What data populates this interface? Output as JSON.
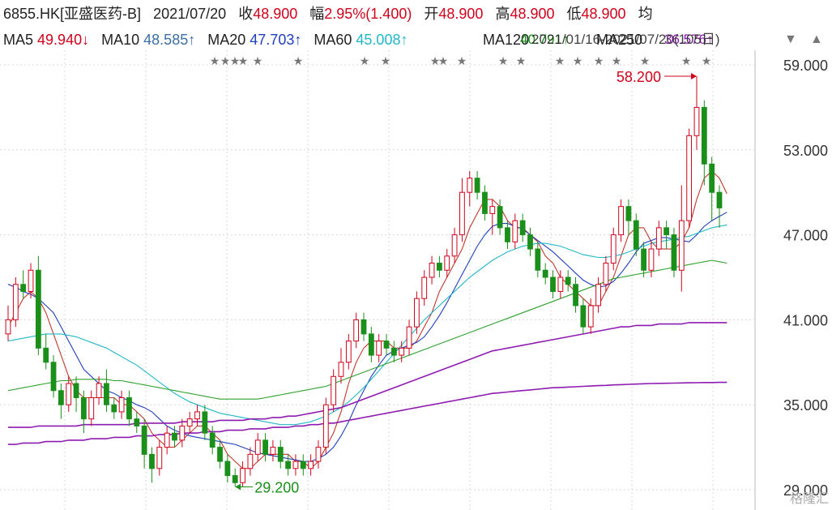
{
  "header": {
    "symbol": "6855.HK[亚盛医药-B]",
    "date": "2021/07/20",
    "close_label": "收",
    "close_value": "48.900",
    "change_label": "幅",
    "change_value": "2.95%(1.400)",
    "open_label": "开",
    "open_value": "48.900",
    "high_label": "高",
    "high_value": "48.900",
    "low_label": "低",
    "low_value": "48.900",
    "avg_label": "均"
  },
  "ma_row": {
    "ma5_label": "MA5",
    "ma5_value": "49.940↓",
    "ma10_label": "MA10",
    "ma10_value": "48.585↑",
    "ma20_label": "MA20",
    "ma20_value": "47.703↑",
    "ma60_label": "MA60",
    "ma60_value": "45.008↑",
    "ma120_label": "MA120",
    "ma120_value": "40.791↑",
    "ma250_label": "MA250",
    "ma250_value": "36.576↑",
    "range_text": "2021/01/16-2021/07/20(105日)"
  },
  "colors": {
    "candle_up": "#d0021b",
    "candle_down": "#1a8f1a",
    "ma5": "#c0392b",
    "ma10": "#1f3fbf",
    "ma20": "#22b8c8",
    "ma60": "#2ca02c",
    "ma120": "#8e1bb0",
    "grid": "#d9d9d9",
    "axis_text": "#333333"
  },
  "chart_data": {
    "type": "candlestick",
    "title": "6855.HK[亚盛医药-B]",
    "date_range": "2021/01/16-2021/07/20",
    "y_ticks": [
      "59.000",
      "53.000",
      "47.000",
      "41.000",
      "35.000",
      "29.000"
    ],
    "ylim": [
      29,
      59
    ],
    "grid": true,
    "annotations": [
      {
        "text": "58.200",
        "type": "high"
      },
      {
        "text": "29.200",
        "type": "low"
      }
    ],
    "candles": [
      [
        40.0,
        41.0,
        39.5,
        42.0
      ],
      [
        41.0,
        43.5,
        40.5,
        44.0
      ],
      [
        43.5,
        43.0,
        42.5,
        44.5
      ],
      [
        43.0,
        44.5,
        42.5,
        45.0
      ],
      [
        44.5,
        39.0,
        38.5,
        45.5
      ],
      [
        39.0,
        38.0,
        37.5,
        40.0
      ],
      [
        38.0,
        36.0,
        35.5,
        38.5
      ],
      [
        36.0,
        35.0,
        34.0,
        36.5
      ],
      [
        35.0,
        36.5,
        34.5,
        37.0
      ],
      [
        36.5,
        35.5,
        34.5,
        37.0
      ],
      [
        35.5,
        34.0,
        33.0,
        36.0
      ],
      [
        34.0,
        35.5,
        33.5,
        36.0
      ],
      [
        35.5,
        36.5,
        35.0,
        37.0
      ],
      [
        36.5,
        35.0,
        34.5,
        37.5
      ],
      [
        35.0,
        34.5,
        34.0,
        35.5
      ],
      [
        34.5,
        35.5,
        34.0,
        36.0
      ],
      [
        35.5,
        34.0,
        33.5,
        36.0
      ],
      [
        34.0,
        33.5,
        33.0,
        34.5
      ],
      [
        33.5,
        31.5,
        30.5,
        34.0
      ],
      [
        31.5,
        30.5,
        29.5,
        32.0
      ],
      [
        30.5,
        32.0,
        30.0,
        32.5
      ],
      [
        32.0,
        33.0,
        31.5,
        33.5
      ],
      [
        33.0,
        32.5,
        32.0,
        33.5
      ],
      [
        32.5,
        33.5,
        32.0,
        34.0
      ],
      [
        33.5,
        34.0,
        33.0,
        34.5
      ],
      [
        34.0,
        34.5,
        33.5,
        35.0
      ],
      [
        34.5,
        33.0,
        32.5,
        35.0
      ],
      [
        33.0,
        32.0,
        31.5,
        33.5
      ],
      [
        32.0,
        31.0,
        30.5,
        32.5
      ],
      [
        31.0,
        30.0,
        29.5,
        31.5
      ],
      [
        30.0,
        29.5,
        29.2,
        30.5
      ],
      [
        29.5,
        30.5,
        29.2,
        31.0
      ],
      [
        30.5,
        31.5,
        30.0,
        32.0
      ],
      [
        31.5,
        32.5,
        31.0,
        33.0
      ],
      [
        32.5,
        31.5,
        31.0,
        33.0
      ],
      [
        31.5,
        32.0,
        31.0,
        32.5
      ],
      [
        32.0,
        31.0,
        30.5,
        32.5
      ],
      [
        31.0,
        30.5,
        30.0,
        31.5
      ],
      [
        30.5,
        31.0,
        30.0,
        31.5
      ],
      [
        31.0,
        30.5,
        30.0,
        31.5
      ],
      [
        30.5,
        31.0,
        30.0,
        31.5
      ],
      [
        31.0,
        32.0,
        30.5,
        32.5
      ],
      [
        32.0,
        35.0,
        31.5,
        35.5
      ],
      [
        35.0,
        37.0,
        34.5,
        37.5
      ],
      [
        37.0,
        38.0,
        36.5,
        39.0
      ],
      [
        38.0,
        39.5,
        37.5,
        40.0
      ],
      [
        39.5,
        41.0,
        39.0,
        41.5
      ],
      [
        41.0,
        40.0,
        39.5,
        41.5
      ],
      [
        40.0,
        38.5,
        38.0,
        40.5
      ],
      [
        38.5,
        39.5,
        38.0,
        40.0
      ],
      [
        39.5,
        39.0,
        38.5,
        40.0
      ],
      [
        39.0,
        38.5,
        38.0,
        39.5
      ],
      [
        38.5,
        39.0,
        38.0,
        39.5
      ],
      [
        39.0,
        40.5,
        38.5,
        41.0
      ],
      [
        40.5,
        42.5,
        40.0,
        43.0
      ],
      [
        42.5,
        44.0,
        42.0,
        44.5
      ],
      [
        44.0,
        45.0,
        43.5,
        45.5
      ],
      [
        45.0,
        44.5,
        44.0,
        45.5
      ],
      [
        44.5,
        45.5,
        44.0,
        46.0
      ],
      [
        45.5,
        47.0,
        45.0,
        47.5
      ],
      [
        47.0,
        50.0,
        46.5,
        51.0
      ],
      [
        50.0,
        51.0,
        49.0,
        51.5
      ],
      [
        51.0,
        50.0,
        49.5,
        51.5
      ],
      [
        50.0,
        48.5,
        48.0,
        50.5
      ],
      [
        48.5,
        49.0,
        47.0,
        49.5
      ],
      [
        49.0,
        47.5,
        47.0,
        49.5
      ],
      [
        47.5,
        46.5,
        46.0,
        48.0
      ],
      [
        46.5,
        48.0,
        46.0,
        48.5
      ],
      [
        48.0,
        47.0,
        46.5,
        48.5
      ],
      [
        47.0,
        46.0,
        45.5,
        47.5
      ],
      [
        46.0,
        44.5,
        44.0,
        46.5
      ],
      [
        44.5,
        44.0,
        43.5,
        45.0
      ],
      [
        44.0,
        43.0,
        42.5,
        44.5
      ],
      [
        43.0,
        44.0,
        42.5,
        44.5
      ],
      [
        44.0,
        43.5,
        43.0,
        44.5
      ],
      [
        43.5,
        42.0,
        41.5,
        44.0
      ],
      [
        42.0,
        40.5,
        40.0,
        42.5
      ],
      [
        40.5,
        42.0,
        40.0,
        42.5
      ],
      [
        42.0,
        43.5,
        41.5,
        44.0
      ],
      [
        43.5,
        45.0,
        43.0,
        45.5
      ],
      [
        45.0,
        47.0,
        44.5,
        47.5
      ],
      [
        47.0,
        49.0,
        46.5,
        49.5
      ],
      [
        49.0,
        48.0,
        47.0,
        49.5
      ],
      [
        48.0,
        46.0,
        45.5,
        48.5
      ],
      [
        46.0,
        44.5,
        44.0,
        46.5
      ],
      [
        44.5,
        46.0,
        44.0,
        46.5
      ],
      [
        46.0,
        47.5,
        45.5,
        48.0
      ],
      [
        47.5,
        47.0,
        46.0,
        48.0
      ],
      [
        47.0,
        44.5,
        44.0,
        47.5
      ],
      [
        44.5,
        48.0,
        43.0,
        50.5
      ],
      [
        48.0,
        54.0,
        47.5,
        54.5
      ],
      [
        54.0,
        56.0,
        53.0,
        58.2
      ],
      [
        56.0,
        52.0,
        50.5,
        56.5
      ],
      [
        52.0,
        50.0,
        48.0,
        52.5
      ],
      [
        50.0,
        48.9,
        47.5,
        50.5
      ]
    ],
    "series": [
      {
        "name": "MA5",
        "values": [
          40.5,
          41.5,
          42.5,
          43.0,
          42.5,
          41.5,
          40.0,
          38.5,
          37.0,
          36.0,
          35.5,
          35.5,
          35.5,
          35.5,
          35.5,
          35.0,
          35.0,
          34.5,
          34.0,
          33.0,
          32.5,
          32.0,
          32.0,
          32.5,
          33.0,
          33.5,
          33.5,
          33.0,
          32.5,
          31.5,
          31.0,
          30.5,
          30.5,
          31.0,
          31.5,
          31.5,
          31.5,
          31.5,
          31.0,
          31.0,
          30.5,
          31.0,
          32.0,
          33.0,
          34.5,
          36.5,
          38.0,
          39.0,
          39.5,
          39.5,
          39.5,
          39.0,
          39.0,
          39.0,
          39.5,
          40.5,
          41.5,
          43.0,
          44.0,
          45.0,
          46.0,
          47.5,
          48.5,
          49.5,
          49.5,
          49.0,
          48.0,
          47.5,
          47.5,
          47.0,
          46.5,
          45.5,
          45.0,
          44.0,
          43.5,
          43.0,
          42.5,
          42.0,
          42.0,
          43.0,
          44.0,
          45.5,
          47.0,
          47.5,
          47.5,
          46.5,
          46.0,
          46.0,
          46.0,
          46.5,
          47.5,
          49.5,
          51.0,
          51.5,
          51.0,
          49.9
        ]
      },
      {
        "name": "MA10",
        "values": [
          43.5,
          43.3,
          43.0,
          42.8,
          42.5,
          42.0,
          41.5,
          40.5,
          39.5,
          38.5,
          37.5,
          37.0,
          36.5,
          36.0,
          35.8,
          35.5,
          35.3,
          35.0,
          34.8,
          34.5,
          34.0,
          33.5,
          33.2,
          33.0,
          32.8,
          32.7,
          32.6,
          32.5,
          32.4,
          32.3,
          32.2,
          32.0,
          31.8,
          31.6,
          31.5,
          31.4,
          31.3,
          31.2,
          31.1,
          31.0,
          31.0,
          31.2,
          31.5,
          32.0,
          32.8,
          33.8,
          35.0,
          36.0,
          37.0,
          37.8,
          38.5,
          38.8,
          39.0,
          39.2,
          39.4,
          39.8,
          40.5,
          41.3,
          42.2,
          43.2,
          44.2,
          45.2,
          46.2,
          47.0,
          47.6,
          47.8,
          47.8,
          47.6,
          47.4,
          47.0,
          46.6,
          46.2,
          45.8,
          45.3,
          44.8,
          44.3,
          43.8,
          43.5,
          43.3,
          43.4,
          43.7,
          44.3,
          45.0,
          45.8,
          46.4,
          46.6,
          46.8,
          46.8,
          46.7,
          46.6,
          46.5,
          47.0,
          47.6,
          48.0,
          48.3,
          48.6
        ]
      },
      {
        "name": "MA20",
        "values": [
          39.5,
          39.6,
          39.7,
          39.8,
          39.9,
          40.0,
          40.0,
          40.0,
          39.9,
          39.8,
          39.6,
          39.4,
          39.2,
          39.0,
          38.7,
          38.4,
          38.1,
          37.8,
          37.4,
          37.0,
          36.6,
          36.2,
          35.8,
          35.5,
          35.2,
          35.0,
          34.8,
          34.6,
          34.4,
          34.3,
          34.2,
          34.1,
          34.0,
          33.9,
          33.8,
          33.7,
          33.6,
          33.6,
          33.6,
          33.7,
          33.8,
          34.0,
          34.2,
          34.5,
          34.8,
          35.2,
          35.7,
          36.2,
          36.8,
          37.4,
          38.0,
          38.6,
          39.2,
          39.8,
          40.4,
          41.0,
          41.5,
          42.0,
          42.5,
          43.0,
          43.5,
          44.0,
          44.4,
          44.8,
          45.2,
          45.5,
          45.8,
          46.0,
          46.2,
          46.3,
          46.4,
          46.4,
          46.3,
          46.2,
          46.0,
          45.8,
          45.6,
          45.5,
          45.4,
          45.4,
          45.5,
          45.6,
          45.8,
          46.0,
          46.2,
          46.4,
          46.5,
          46.6,
          46.7,
          46.8,
          46.9,
          47.1,
          47.3,
          47.5,
          47.6,
          47.7
        ]
      },
      {
        "name": "MA60",
        "values": [
          36.0,
          36.1,
          36.2,
          36.3,
          36.4,
          36.5,
          36.6,
          36.7,
          36.7,
          36.8,
          36.8,
          36.8,
          36.8,
          36.8,
          36.7,
          36.7,
          36.6,
          36.5,
          36.4,
          36.3,
          36.2,
          36.1,
          36.0,
          35.9,
          35.8,
          35.7,
          35.6,
          35.5,
          35.4,
          35.4,
          35.4,
          35.4,
          35.4,
          35.4,
          35.5,
          35.6,
          35.7,
          35.8,
          35.9,
          36.0,
          36.1,
          36.2,
          36.3,
          36.5,
          36.7,
          36.9,
          37.1,
          37.3,
          37.5,
          37.7,
          37.9,
          38.1,
          38.3,
          38.5,
          38.7,
          38.9,
          39.1,
          39.3,
          39.5,
          39.7,
          39.9,
          40.1,
          40.3,
          40.5,
          40.7,
          40.9,
          41.1,
          41.3,
          41.5,
          41.7,
          41.9,
          42.1,
          42.3,
          42.5,
          42.7,
          42.9,
          43.1,
          43.3,
          43.5,
          43.7,
          43.9,
          44.0,
          44.1,
          44.2,
          44.3,
          44.4,
          44.5,
          44.6,
          44.7,
          44.8,
          44.9,
          45.0,
          45.1,
          45.2,
          45.1,
          45.0
        ]
      },
      {
        "name": "MA120",
        "values": [
          33.4,
          33.4,
          33.4,
          33.4,
          33.5,
          33.5,
          33.5,
          33.5,
          33.5,
          33.5,
          33.6,
          33.6,
          33.6,
          33.6,
          33.6,
          33.6,
          33.6,
          33.7,
          33.7,
          33.7,
          33.7,
          33.7,
          33.7,
          33.8,
          33.8,
          33.8,
          33.8,
          33.8,
          33.9,
          33.9,
          33.9,
          33.9,
          34.0,
          34.0,
          34.0,
          34.1,
          34.1,
          34.2,
          34.2,
          34.3,
          34.4,
          34.5,
          34.6,
          34.7,
          34.8,
          35.0,
          35.2,
          35.4,
          35.6,
          35.8,
          36.0,
          36.2,
          36.4,
          36.6,
          36.8,
          37.0,
          37.2,
          37.4,
          37.6,
          37.8,
          38.0,
          38.2,
          38.4,
          38.6,
          38.8,
          38.9,
          39.0,
          39.1,
          39.2,
          39.3,
          39.4,
          39.5,
          39.6,
          39.7,
          39.8,
          39.9,
          40.0,
          40.1,
          40.2,
          40.3,
          40.4,
          40.5,
          40.5,
          40.6,
          40.6,
          40.6,
          40.7,
          40.7,
          40.7,
          40.7,
          40.8,
          40.8,
          40.8,
          40.8,
          40.8,
          40.8
        ]
      },
      {
        "name": "MA250",
        "values": [
          32.2,
          32.2,
          32.3,
          32.3,
          32.3,
          32.4,
          32.4,
          32.4,
          32.5,
          32.5,
          32.5,
          32.6,
          32.6,
          32.6,
          32.7,
          32.7,
          32.7,
          32.8,
          32.8,
          32.8,
          32.9,
          32.9,
          32.9,
          33.0,
          33.0,
          33.0,
          33.1,
          33.1,
          33.1,
          33.2,
          33.2,
          33.2,
          33.3,
          33.3,
          33.3,
          33.4,
          33.4,
          33.4,
          33.5,
          33.5,
          33.6,
          33.6,
          33.7,
          33.7,
          33.8,
          33.9,
          34.0,
          34.1,
          34.2,
          34.3,
          34.4,
          34.5,
          34.6,
          34.7,
          34.8,
          34.9,
          35.0,
          35.1,
          35.2,
          35.3,
          35.4,
          35.5,
          35.6,
          35.7,
          35.8,
          35.85,
          35.9,
          35.95,
          36.0,
          36.05,
          36.1,
          36.15,
          36.2,
          36.22,
          36.25,
          36.27,
          36.3,
          36.32,
          36.35,
          36.37,
          36.4,
          36.42,
          36.44,
          36.46,
          36.48,
          36.5,
          36.51,
          36.52,
          36.53,
          36.54,
          36.55,
          36.56,
          36.57,
          36.57,
          36.58,
          36.58
        ]
      }
    ]
  },
  "watermark": "格隆汇"
}
